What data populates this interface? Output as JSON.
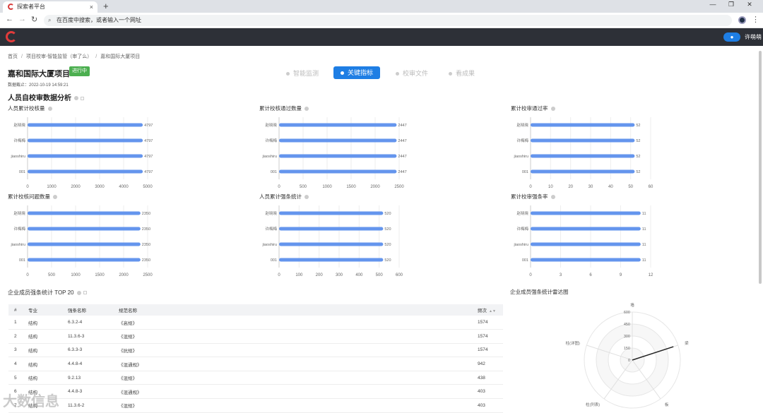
{
  "browser": {
    "tab_title": "探索者平台",
    "tab_close": "×",
    "new_tab": "+",
    "omnibox_placeholder": "在百度中搜索，或者输入一个网址",
    "win_controls": [
      "—",
      "❐",
      "✕"
    ]
  },
  "header": {
    "user_name": "许萌萌"
  },
  "breadcrumb": [
    "首页",
    "项目校审-智能监管（审了么）",
    "嘉和国际大厦项目"
  ],
  "project": {
    "title": "嘉和国际大厦项目",
    "status": "进行中",
    "deadline_label": "数据截止：",
    "deadline": "2022-10-19 14:59:21"
  },
  "steps": [
    {
      "label": "智能监测",
      "active": false
    },
    {
      "label": "关键指标",
      "active": true
    },
    {
      "label": "校审文件",
      "active": false
    },
    {
      "label": "看成果",
      "active": false
    }
  ],
  "section_title": "人员自校审数据分析",
  "colors": {
    "bar": "#6495ed",
    "accent": "#1e7ee4",
    "badge": "#4caf50",
    "radar_line": "#222222"
  },
  "chart_data": [
    {
      "type": "bar",
      "orientation": "horizontal",
      "title": "人员累计校核量",
      "categories": [
        "赵晓晓",
        "许梅梅",
        "jiaoshiru",
        "001"
      ],
      "values": [
        4797,
        4797,
        4797,
        4797
      ],
      "value_labels": [
        "4797",
        "4797",
        "4797",
        "4797"
      ],
      "xticks": [
        "0",
        "1000",
        "2000",
        "3000",
        "4000",
        "5000"
      ],
      "xlim": [
        0,
        5000
      ]
    },
    {
      "type": "bar",
      "orientation": "horizontal",
      "title": "累计校核通过数量",
      "categories": [
        "赵晓晓",
        "许梅梅",
        "jiaoshiru",
        "001"
      ],
      "values": [
        2447,
        2447,
        2447,
        2447
      ],
      "value_labels": [
        "2447",
        "2447",
        "2447",
        "2447"
      ],
      "xticks": [
        "0",
        "500",
        "1000",
        "1500",
        "2000",
        "2500"
      ],
      "xlim": [
        0,
        2500
      ]
    },
    {
      "type": "bar",
      "orientation": "horizontal",
      "title": "累计校审通过率",
      "categories": [
        "赵晓晓",
        "许梅梅",
        "jiaoshiru",
        "001"
      ],
      "values": [
        52,
        52,
        52,
        52
      ],
      "value_labels": [
        "52",
        "52",
        "52",
        "52"
      ],
      "xticks": [
        "0",
        "10",
        "20",
        "30",
        "40",
        "50",
        "60"
      ],
      "xlim": [
        0,
        60
      ]
    },
    {
      "type": "bar",
      "orientation": "horizontal",
      "title": "累计校核问题数量",
      "categories": [
        "赵晓晓",
        "许梅梅",
        "jiaoshiru",
        "001"
      ],
      "values": [
        2350,
        2350,
        2350,
        2350
      ],
      "value_labels": [
        "2350",
        "2350",
        "2350",
        "2350"
      ],
      "xticks": [
        "0",
        "500",
        "1000",
        "1500",
        "2000",
        "2500"
      ],
      "xlim": [
        0,
        2500
      ]
    },
    {
      "type": "bar",
      "orientation": "horizontal",
      "title": "人员累计强条统计",
      "categories": [
        "赵晓晓",
        "许梅梅",
        "jiaoshiru",
        "001"
      ],
      "values": [
        520,
        520,
        520,
        520
      ],
      "value_labels": [
        "520",
        "520",
        "520",
        "520"
      ],
      "xticks": [
        "0",
        "100",
        "200",
        "300",
        "400",
        "500",
        "600"
      ],
      "xlim": [
        0,
        600
      ]
    },
    {
      "type": "bar",
      "orientation": "horizontal",
      "title": "累计校审强条率",
      "categories": [
        "赵晓晓",
        "许梅梅",
        "jiaoshiru",
        "001"
      ],
      "values": [
        11,
        11,
        11,
        11
      ],
      "value_labels": [
        "11",
        "11",
        "11",
        "11"
      ],
      "xticks": [
        "0",
        "3",
        "6",
        "9",
        "12"
      ],
      "xlim": [
        0,
        12
      ]
    },
    {
      "type": "radar",
      "title": "企业成员强条统计雷达图",
      "indicators": [
        "墙",
        "梁",
        "板",
        "柱(列表)",
        "柱(详图)"
      ],
      "rings": [
        "0",
        "150",
        "300",
        "450",
        "600"
      ],
      "max": 600,
      "values": [
        0,
        540,
        0,
        0,
        0
      ]
    }
  ],
  "table": {
    "title": "企业成员强条统计 TOP 20",
    "headers": [
      "#",
      "专业",
      "强条名称",
      "规范名称",
      "频次"
    ],
    "rows": [
      [
        "1",
        "结构",
        "6.3.2-4",
        "《高规》",
        "1574"
      ],
      [
        "2",
        "结构",
        "11.3.6-3",
        "《混规》",
        "1574"
      ],
      [
        "3",
        "结构",
        "6.3.3-3",
        "《抗规》",
        "1574"
      ],
      [
        "4",
        "结构",
        "4.4.8-4",
        "《混通规》",
        "942"
      ],
      [
        "5",
        "结构",
        "9.2.13",
        "《混规》",
        "438"
      ],
      [
        "6",
        "结构",
        "4.4.8-3",
        "《混通规》",
        "403"
      ],
      [
        "7",
        "结构",
        "11.3.6-2",
        "《混规》",
        "403"
      ]
    ]
  },
  "watermark": "大数信息"
}
